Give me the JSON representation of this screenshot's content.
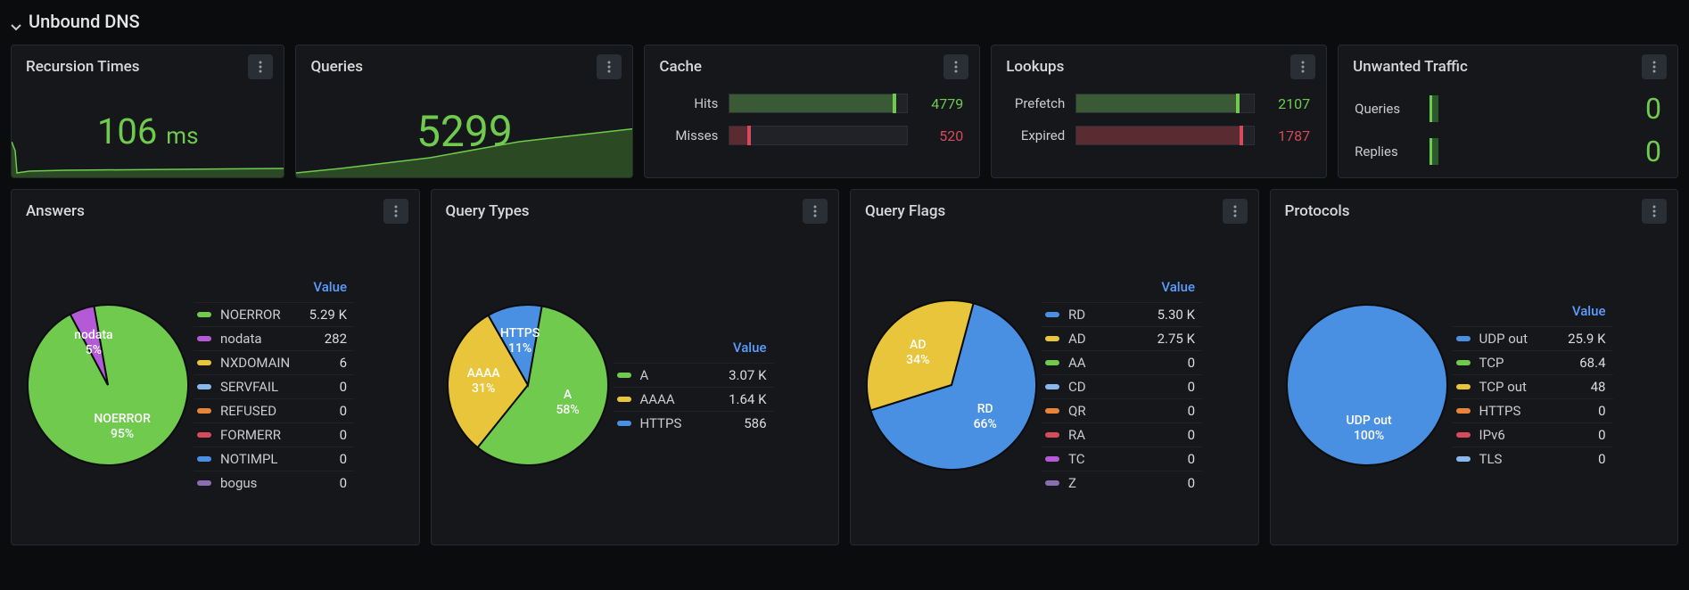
{
  "section": {
    "title": "Unbound DNS"
  },
  "colors": {
    "green": "#6fca4e",
    "darkgreen": "#3a5a36",
    "red": "#d64a5b",
    "darkred": "#5a2c31",
    "yellow": "#e8c53a",
    "blue": "#4a90e2",
    "lightblue": "#8ab8ed",
    "orange": "#e8853a",
    "magenta": "#b45ad6",
    "purple": "#8a6fb0"
  },
  "legend_header": "Value",
  "panels": {
    "recursion": {
      "title": "Recursion Times",
      "value": "106",
      "unit": "ms"
    },
    "queries": {
      "title": "Queries",
      "value": "5299"
    },
    "cache": {
      "title": "Cache",
      "rows": [
        {
          "label": "Hits",
          "value": "4779",
          "fill": 0.92,
          "color": "green",
          "track": "darkgreen"
        },
        {
          "label": "Misses",
          "value": "520",
          "fill": 0.1,
          "color": "red",
          "track": "darkred"
        }
      ]
    },
    "lookups": {
      "title": "Lookups",
      "rows": [
        {
          "label": "Prefetch",
          "value": "2107",
          "fill": 0.9,
          "color": "green",
          "track": "darkgreen"
        },
        {
          "label": "Expired",
          "value": "1787",
          "fill": 0.92,
          "color": "red",
          "track": "darkred"
        }
      ]
    },
    "unwanted": {
      "title": "Unwanted Traffic",
      "rows": [
        {
          "label": "Queries",
          "value": "0"
        },
        {
          "label": "Replies",
          "value": "0"
        }
      ]
    },
    "answers": {
      "title": "Answers",
      "items": [
        {
          "name": "NOERROR",
          "value": "5.29 K",
          "color": "green",
          "pct": 95,
          "pie_label": "NOERROR\n95%"
        },
        {
          "name": "nodata",
          "value": "282",
          "color": "magenta",
          "pct": 5,
          "pie_label": "nodata\n5%"
        },
        {
          "name": "NXDOMAIN",
          "value": "6",
          "color": "yellow",
          "pct": 0
        },
        {
          "name": "SERVFAIL",
          "value": "0",
          "color": "lightblue",
          "pct": 0
        },
        {
          "name": "REFUSED",
          "value": "0",
          "color": "orange",
          "pct": 0
        },
        {
          "name": "FORMERR",
          "value": "0",
          "color": "red",
          "pct": 0
        },
        {
          "name": "NOTIMPL",
          "value": "0",
          "color": "blue",
          "pct": 0
        },
        {
          "name": "bogus",
          "value": "0",
          "color": "purple",
          "pct": 0
        }
      ]
    },
    "qtypes": {
      "title": "Query Types",
      "items": [
        {
          "name": "A",
          "value": "3.07 K",
          "color": "green",
          "pct": 58,
          "pie_label": "A\n58%"
        },
        {
          "name": "AAAA",
          "value": "1.64 K",
          "color": "yellow",
          "pct": 31,
          "pie_label": "AAAA\n31%"
        },
        {
          "name": "HTTPS",
          "value": "586",
          "color": "blue",
          "pct": 11,
          "pie_label": "HTTPS\n11%"
        }
      ]
    },
    "qflags": {
      "title": "Query Flags",
      "items": [
        {
          "name": "RD",
          "value": "5.30 K",
          "color": "blue",
          "pct": 66,
          "pie_label": "RD\n66%"
        },
        {
          "name": "AD",
          "value": "2.75 K",
          "color": "yellow",
          "pct": 34,
          "pie_label": "AD\n34%"
        },
        {
          "name": "AA",
          "value": "0",
          "color": "green",
          "pct": 0
        },
        {
          "name": "CD",
          "value": "0",
          "color": "lightblue",
          "pct": 0
        },
        {
          "name": "QR",
          "value": "0",
          "color": "orange",
          "pct": 0
        },
        {
          "name": "RA",
          "value": "0",
          "color": "red",
          "pct": 0
        },
        {
          "name": "TC",
          "value": "0",
          "color": "magenta",
          "pct": 0
        },
        {
          "name": "Z",
          "value": "0",
          "color": "purple",
          "pct": 0
        }
      ]
    },
    "protocols": {
      "title": "Protocols",
      "items": [
        {
          "name": "UDP out",
          "value": "25.9 K",
          "color": "blue",
          "pct": 100,
          "pie_label": "UDP out\n100%"
        },
        {
          "name": "TCP",
          "value": "68.4",
          "color": "green",
          "pct": 0
        },
        {
          "name": "TCP out",
          "value": "48",
          "color": "yellow",
          "pct": 0
        },
        {
          "name": "HTTPS",
          "value": "0",
          "color": "orange",
          "pct": 0
        },
        {
          "name": "IPv6",
          "value": "0",
          "color": "red",
          "pct": 0
        },
        {
          "name": "TLS",
          "value": "0",
          "color": "lightblue",
          "pct": 0
        }
      ]
    }
  },
  "chart_data": [
    {
      "type": "line",
      "title": "Recursion Times",
      "ylabel": "ms",
      "summary_value": 106
    },
    {
      "type": "line",
      "title": "Queries",
      "summary_value": 5299
    },
    {
      "type": "bar",
      "title": "Cache",
      "categories": [
        "Hits",
        "Misses"
      ],
      "values": [
        4779,
        520
      ]
    },
    {
      "type": "bar",
      "title": "Lookups",
      "categories": [
        "Prefetch",
        "Expired"
      ],
      "values": [
        2107,
        1787
      ]
    },
    {
      "type": "bar",
      "title": "Unwanted Traffic",
      "categories": [
        "Queries",
        "Replies"
      ],
      "values": [
        0,
        0
      ]
    },
    {
      "type": "pie",
      "title": "Answers",
      "series": [
        {
          "name": "NOERROR",
          "value": 5290
        },
        {
          "name": "nodata",
          "value": 282
        },
        {
          "name": "NXDOMAIN",
          "value": 6
        },
        {
          "name": "SERVFAIL",
          "value": 0
        },
        {
          "name": "REFUSED",
          "value": 0
        },
        {
          "name": "FORMERR",
          "value": 0
        },
        {
          "name": "NOTIMPL",
          "value": 0
        },
        {
          "name": "bogus",
          "value": 0
        }
      ]
    },
    {
      "type": "pie",
      "title": "Query Types",
      "series": [
        {
          "name": "A",
          "value": 3070
        },
        {
          "name": "AAAA",
          "value": 1640
        },
        {
          "name": "HTTPS",
          "value": 586
        }
      ]
    },
    {
      "type": "pie",
      "title": "Query Flags",
      "series": [
        {
          "name": "RD",
          "value": 5300
        },
        {
          "name": "AD",
          "value": 2750
        },
        {
          "name": "AA",
          "value": 0
        },
        {
          "name": "CD",
          "value": 0
        },
        {
          "name": "QR",
          "value": 0
        },
        {
          "name": "RA",
          "value": 0
        },
        {
          "name": "TC",
          "value": 0
        },
        {
          "name": "Z",
          "value": 0
        }
      ]
    },
    {
      "type": "pie",
      "title": "Protocols",
      "series": [
        {
          "name": "UDP out",
          "value": 25900
        },
        {
          "name": "TCP",
          "value": 68.4
        },
        {
          "name": "TCP out",
          "value": 48
        },
        {
          "name": "HTTPS",
          "value": 0
        },
        {
          "name": "IPv6",
          "value": 0
        },
        {
          "name": "TLS",
          "value": 0
        }
      ]
    }
  ]
}
